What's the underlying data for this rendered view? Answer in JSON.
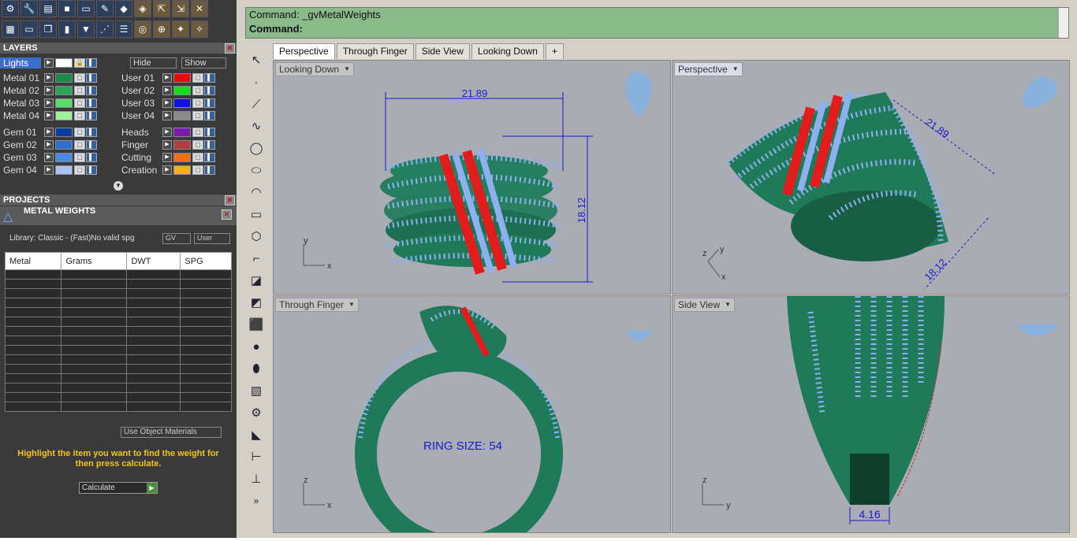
{
  "command": {
    "line1": "Command: _gvMetalWeights",
    "line2": "Command:"
  },
  "layers": {
    "title": "LAYERS",
    "lights_label": "Lights",
    "hide_label": "Hide",
    "show_label": "Show",
    "left": [
      {
        "name": "Metal 01",
        "color": "#1b8a4a"
      },
      {
        "name": "Metal 02",
        "color": "#2aa65a"
      },
      {
        "name": "Metal 03",
        "color": "#5ddc6c"
      },
      {
        "name": "Metal 04",
        "color": "#9ff09a"
      },
      {
        "name": "Gem 01",
        "color": "#0a3d9c"
      },
      {
        "name": "Gem 02",
        "color": "#2f6fd0"
      },
      {
        "name": "Gem 03",
        "color": "#4a8ae8"
      },
      {
        "name": "Gem 04",
        "color": "#a8c4f0"
      }
    ],
    "right": [
      {
        "name": "User 01",
        "color": "#e01010"
      },
      {
        "name": "User 02",
        "color": "#10e020"
      },
      {
        "name": "User 03",
        "color": "#1010e0"
      },
      {
        "name": "User 04",
        "color": "#8a8a8a"
      },
      {
        "name": "Heads",
        "color": "#7a1ab0"
      },
      {
        "name": "Finger",
        "color": "#b04040"
      },
      {
        "name": "Cutting",
        "color": "#f07010"
      },
      {
        "name": "Creation",
        "color": "#f0b020"
      }
    ]
  },
  "projects": {
    "title": "PROJECTS",
    "panel_title": "METAL WEIGHTS",
    "library": "Library: Classic - (Fast)No valid spg",
    "gv_label": "GV",
    "user_label": "User",
    "columns": [
      "Metal",
      "Grams",
      "DWT",
      "SPG"
    ],
    "use_object_materials": "Use Object Materials",
    "hint": "Highlight the item you want to find the weight for then press calculate.",
    "calculate": "Calculate"
  },
  "tabs": [
    "Perspective",
    "Through Finger",
    "Side View",
    "Looking Down",
    "+"
  ],
  "viewports": {
    "top_left": {
      "label": "Looking Down",
      "dim_w": "21.89",
      "dim_h": "18.12"
    },
    "top_right": {
      "label": "Perspective",
      "dim_a": "21.89",
      "dim_b": "18.12"
    },
    "bottom_left": {
      "label": "Through Finger",
      "ring_size": "RING SIZE: 54"
    },
    "bottom_right": {
      "label": "Side View",
      "dim": "4.16"
    }
  },
  "axes": {
    "x": "x",
    "y": "y",
    "z": "z"
  },
  "colors": {
    "metal": "#1f7a5a",
    "gem": "#8fb0f0",
    "prong": "#5a1f8a",
    "ruby": "#e41b1b",
    "dim": "#1a1ad0"
  }
}
